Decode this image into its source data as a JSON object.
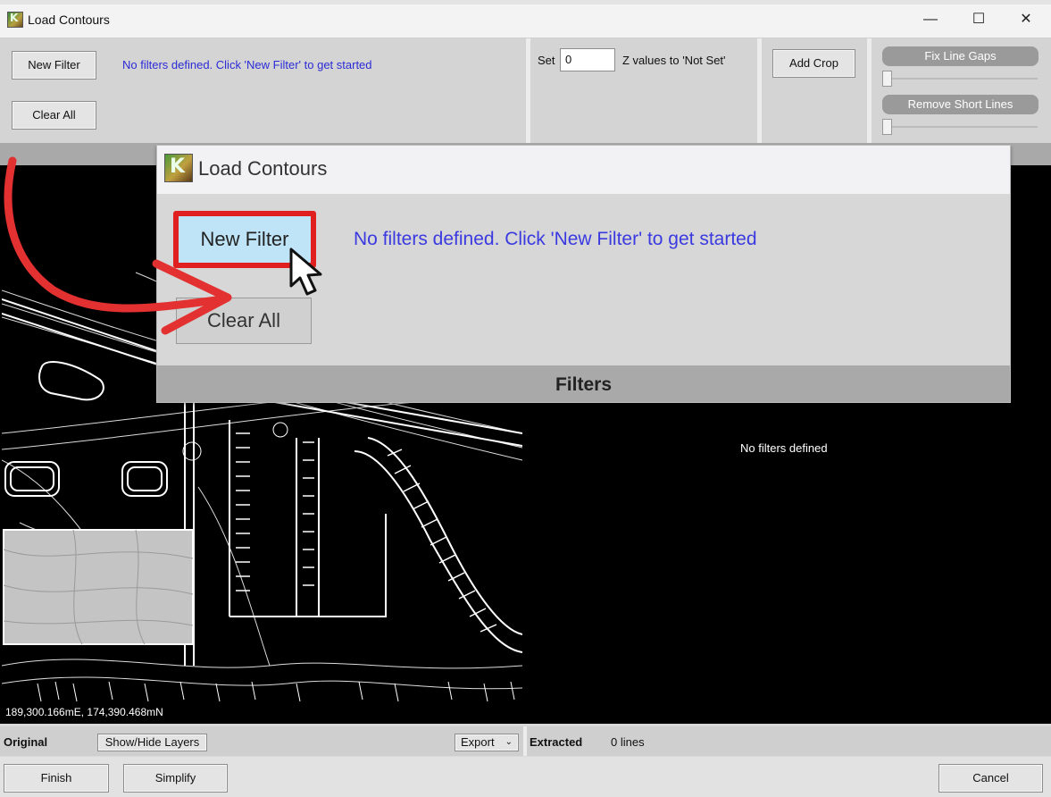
{
  "window": {
    "title": "Load Contours",
    "minimize": "—",
    "maximize": "☐",
    "close": "✕"
  },
  "toolbar": {
    "new_filter": "New Filter",
    "clear_all": "Clear All",
    "no_filters_msg": "No filters defined. Click 'New Filter' to get started",
    "set_label": "Set",
    "set_value": "0",
    "z_values_label": "Z values to 'Not Set'",
    "add_crop": "Add Crop",
    "fix_line_gaps": "Fix Line Gaps",
    "remove_short_lines": "Remove Short Lines"
  },
  "views": {
    "coordinates": "189,300.166mE, 174,390.468mN",
    "right_message": "No filters defined"
  },
  "status": {
    "original_label": "Original",
    "show_hide_layers": "Show/Hide Layers",
    "export": "Export",
    "extracted_label": "Extracted",
    "line_count": "0 lines"
  },
  "footer": {
    "finish": "Finish",
    "simplify": "Simplify",
    "cancel": "Cancel"
  },
  "zoom_callout": {
    "title": "Load Contours",
    "new_filter": "New Filter",
    "clear_all": "Clear All",
    "message": "No filters defined. Click 'New Filter' to get started",
    "filters_header": "Filters"
  },
  "colors": {
    "highlight": "#e02020",
    "link_text": "#2b2bd6",
    "canvas_bg": "#000000"
  }
}
